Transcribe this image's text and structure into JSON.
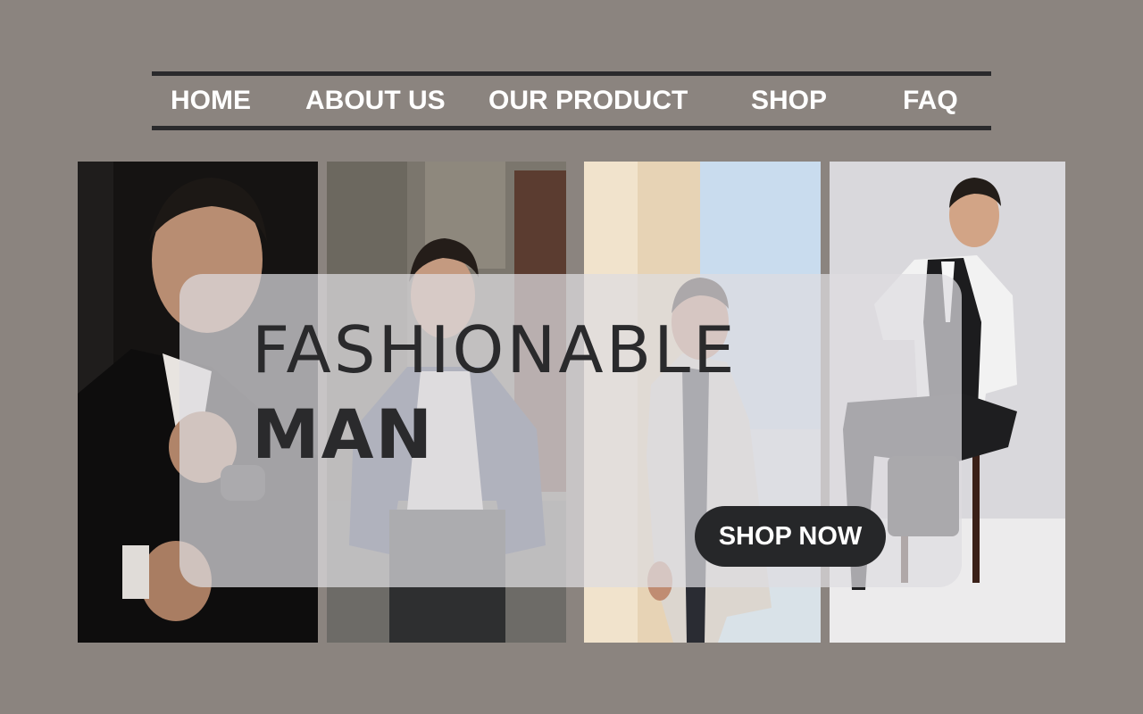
{
  "nav": {
    "items": [
      {
        "label": "HOME"
      },
      {
        "label": "ABOUT US"
      },
      {
        "label": "OUR PRODUCT"
      },
      {
        "label": "SHOP"
      },
      {
        "label": "FAQ"
      }
    ]
  },
  "hero": {
    "title_line1": "FASHIONABLE",
    "title_line2": "MAN",
    "cta_label": "SHOP NOW"
  },
  "colors": {
    "background": "#8b847f",
    "nav_rule": "#2a2a2c",
    "text_dark": "#2a2a2c",
    "button_bg": "#262729",
    "button_text": "#ffffff"
  }
}
